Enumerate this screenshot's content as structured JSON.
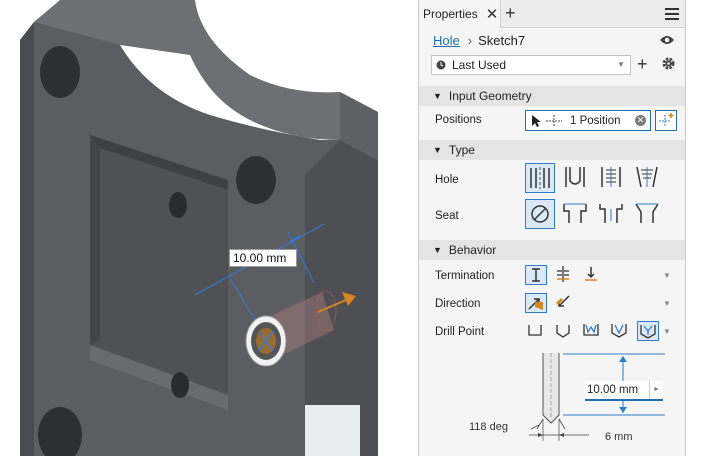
{
  "viewport": {
    "dimension_label": "10.00 mm"
  },
  "panel": {
    "tab_label": "Properties",
    "breadcrumb_link": "Hole",
    "breadcrumb_current": "Sketch7",
    "preset_value": "Last Used",
    "sections": {
      "input_geometry": "Input Geometry",
      "type": "Type",
      "behavior": "Behavior"
    },
    "rows": {
      "positions": "Positions",
      "hole": "Hole",
      "seat": "Seat",
      "termination": "Termination",
      "direction": "Direction",
      "drill_point": "Drill Point"
    },
    "positions_value": "1 Position",
    "diagram": {
      "depth_value": "10.00 mm",
      "angle_label": "118 deg",
      "diameter_label": "6 mm"
    }
  },
  "colors": {
    "accent": "#1f6fb5",
    "selected_bg": "#dbe8f5",
    "section_bg": "#e4e4e4",
    "model_face": "#5f6064",
    "arrow_orange": "#d6861f"
  }
}
